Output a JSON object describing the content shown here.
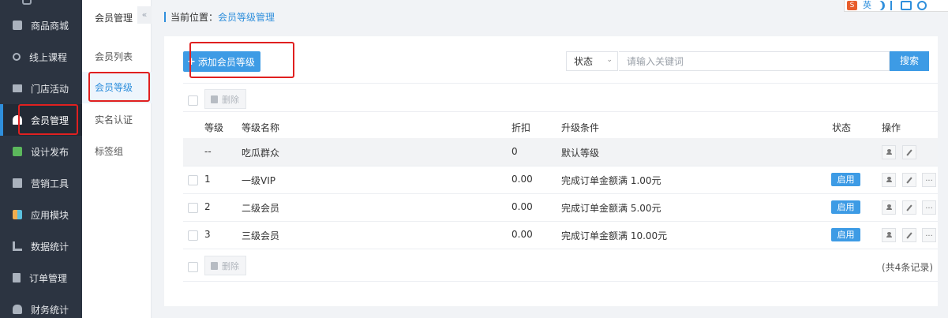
{
  "nav": {
    "items": [
      {
        "label": "商品商城",
        "icon": "shop-icon"
      },
      {
        "label": "线上课程",
        "icon": "course-icon"
      },
      {
        "label": "门店活动",
        "icon": "store-icon"
      },
      {
        "label": "会员管理",
        "icon": "member-icon"
      },
      {
        "label": "设计发布",
        "icon": "design-icon"
      },
      {
        "label": "营销工具",
        "icon": "gift-icon"
      },
      {
        "label": "应用模块",
        "icon": "apps-icon"
      },
      {
        "label": "数据统计",
        "icon": "chart-icon"
      },
      {
        "label": "订单管理",
        "icon": "order-icon"
      },
      {
        "label": "财务统计",
        "icon": "finance-icon"
      }
    ]
  },
  "subnav": {
    "title": "会员管理",
    "collapse": "«",
    "items": [
      "会员列表",
      "会员等级",
      "实名认证",
      "标签组"
    ]
  },
  "breadcrumb": {
    "label": "当前位置：",
    "current": "会员等级管理"
  },
  "toolbar": {
    "add_label": "添加会员等级",
    "status_select": "状态",
    "search_placeholder": "请输入关键词",
    "search_label": "搜索",
    "delete_label": "删除"
  },
  "tray": {
    "sogou": "S",
    "lang": "英"
  },
  "table": {
    "headers": [
      "等级",
      "等级名称",
      "折扣",
      "升级条件",
      "状态",
      "操作"
    ],
    "rows": [
      {
        "level": "--",
        "name": "吃瓜群众",
        "discount": "0",
        "condition": "默认等级",
        "status": ""
      },
      {
        "level": "1",
        "name": "一级VIP",
        "discount": "0.00",
        "condition": "完成订单金额满 1.00元",
        "status": "启用"
      },
      {
        "level": "2",
        "name": "二级会员",
        "discount": "0.00",
        "condition": "完成订单金额满 5.00元",
        "status": "启用"
      },
      {
        "level": "3",
        "name": "三级会员",
        "discount": "0.00",
        "condition": "完成订单金额满 10.00元",
        "status": "启用"
      }
    ],
    "more": "...",
    "total": "(共4条记录)"
  },
  "colors": {
    "accent": "#3d9be5",
    "sidebar": "#2c3441",
    "annotation": "#e02020"
  }
}
